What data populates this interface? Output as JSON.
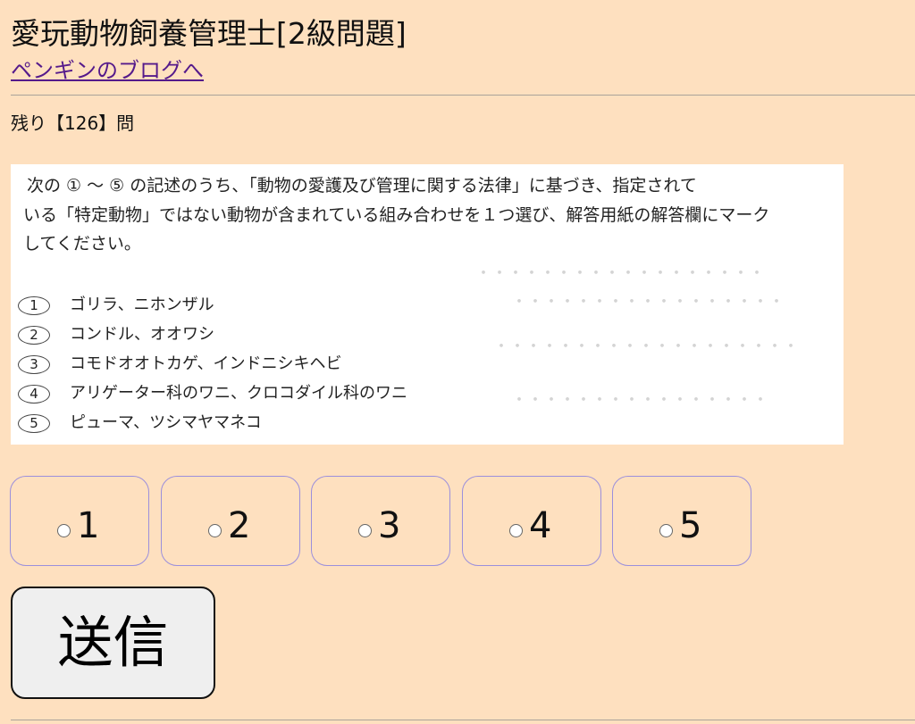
{
  "page": {
    "title": "愛玩動物飼養管理士[2級問題]",
    "blog_link": "ペンギンのブログへ",
    "remaining": "残り【126】問"
  },
  "question": {
    "lines": [
      "次の ① 〜 ⑤ の記述のうち、「動物の愛護及び管理に関する法律」に基づき、指定されて",
      "いる「特定動物」ではない動物が含まれている組み合わせを１つ選び、解答用紙の解答欄にマーク",
      "してください。"
    ],
    "choices": [
      {
        "num": "1",
        "text": "ゴリラ、ニホンザル"
      },
      {
        "num": "2",
        "text": "コンドル、オオワシ"
      },
      {
        "num": "3",
        "text": "コモドオオトカゲ、インドニシキヘビ"
      },
      {
        "num": "4",
        "text": "アリゲーター科のワニ、クロコダイル科のワニ"
      },
      {
        "num": "5",
        "text": "ピューマ、ツシマヤマネコ"
      }
    ]
  },
  "options": [
    {
      "label": "1"
    },
    {
      "label": "2"
    },
    {
      "label": "3"
    },
    {
      "label": "4"
    },
    {
      "label": "5"
    }
  ],
  "submit_label": "送信"
}
